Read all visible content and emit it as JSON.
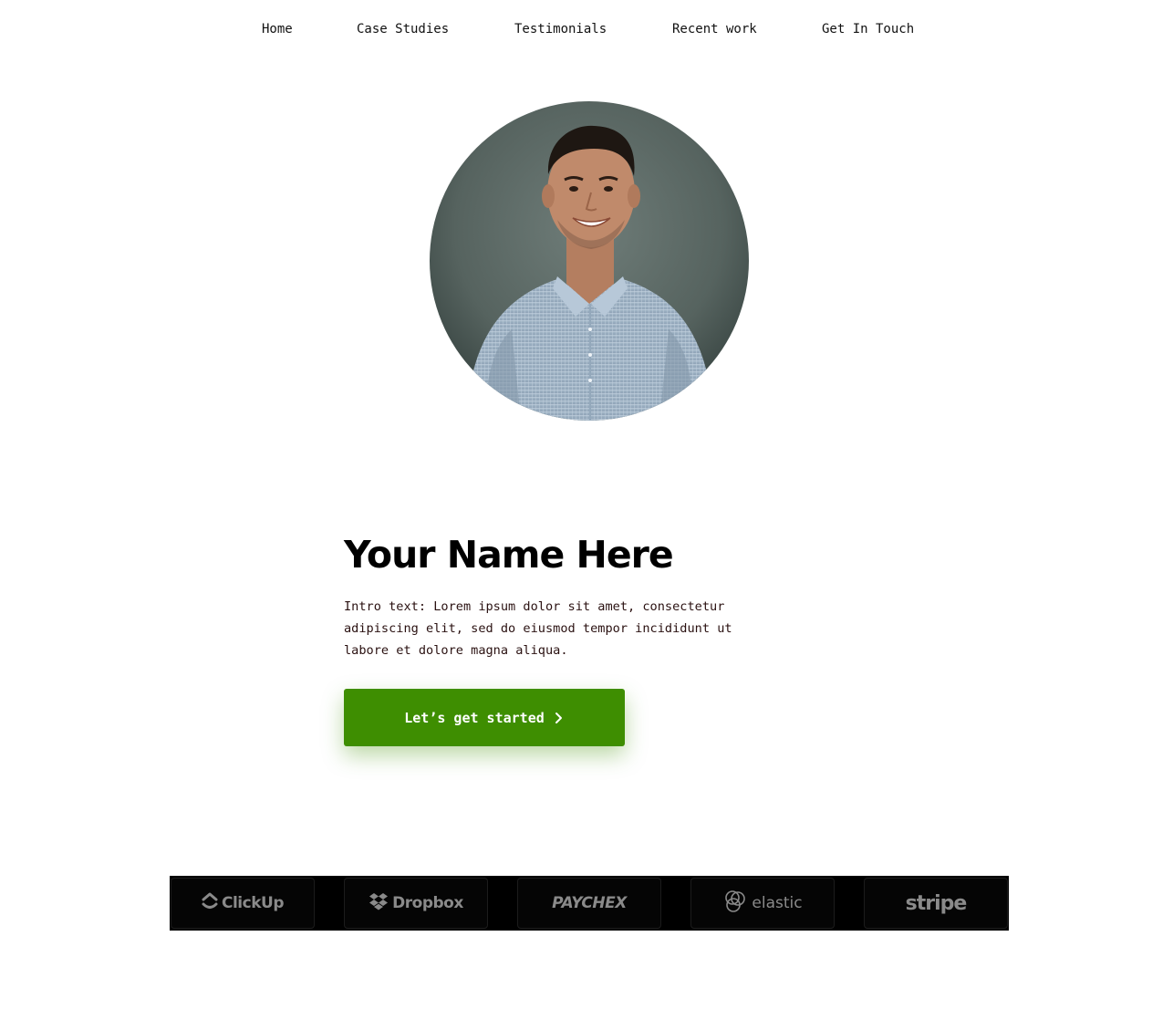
{
  "nav": {
    "items": [
      {
        "label": "Home"
      },
      {
        "label": "Case Studies"
      },
      {
        "label": "Testimonials"
      },
      {
        "label": "Recent work"
      },
      {
        "label": "Get In Touch"
      }
    ]
  },
  "hero": {
    "name": "Your Name Here",
    "intro": "Intro text: Lorem ipsum dolor sit amet, consectetur adipiscing elit, sed do eiusmod tempor incididunt ut labore et dolore magna aliqua.",
    "cta_label": "Let’s get started",
    "cta_color": "#3e8e01"
  },
  "logos": {
    "items": [
      {
        "name": "ClickUp",
        "icon": "clickup-icon"
      },
      {
        "name": "Dropbox",
        "icon": "dropbox-icon"
      },
      {
        "name": "PAYCHEX",
        "icon": ""
      },
      {
        "name": "elastic",
        "icon": "elastic-icon"
      },
      {
        "name": "stripe",
        "icon": ""
      }
    ]
  }
}
